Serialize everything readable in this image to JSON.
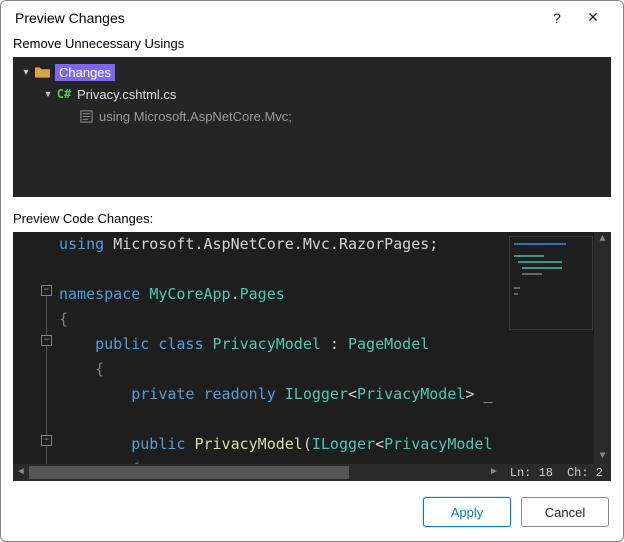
{
  "dialog": {
    "title": "Preview Changes",
    "help": "?",
    "close": "✕"
  },
  "sections": {
    "tree_label": "Remove Unnecessary Usings",
    "code_label": "Preview Code Changes:"
  },
  "tree": {
    "root": {
      "label": "Changes"
    },
    "file": {
      "label": "Privacy.cshtml.cs",
      "lang_badge": "C#"
    },
    "removed": {
      "label": "using Microsoft.AspNetCore.Mvc;"
    }
  },
  "code": {
    "tokens": [
      [
        [
          "k",
          "using "
        ],
        [
          "p",
          "Microsoft.AspNetCore.Mvc.RazorPages;"
        ]
      ],
      [],
      [
        [
          "k",
          "namespace "
        ],
        [
          "t",
          "MyCoreApp"
        ],
        [
          "p",
          "."
        ],
        [
          "t",
          "Pages"
        ]
      ],
      [
        [
          "b",
          "{"
        ]
      ],
      [
        [
          "p",
          "    "
        ],
        [
          "k",
          "public class "
        ],
        [
          "t",
          "PrivacyModel"
        ],
        [
          "p",
          " : "
        ],
        [
          "t",
          "PageModel"
        ]
      ],
      [
        [
          "p",
          "    "
        ],
        [
          "b",
          "{"
        ]
      ],
      [
        [
          "p",
          "        "
        ],
        [
          "k",
          "private readonly "
        ],
        [
          "t",
          "ILogger"
        ],
        [
          "p",
          "<"
        ],
        [
          "t",
          "PrivacyModel"
        ],
        [
          "p",
          "> _"
        ]
      ],
      [],
      [
        [
          "p",
          "        "
        ],
        [
          "k",
          "public "
        ],
        [
          "m",
          "PrivacyModel"
        ],
        [
          "p",
          "("
        ],
        [
          "t",
          "ILogger"
        ],
        [
          "p",
          "<"
        ],
        [
          "t",
          "PrivacyModel"
        ]
      ],
      [
        [
          "p",
          "        "
        ],
        [
          "b",
          "{"
        ]
      ]
    ]
  },
  "status": {
    "line_label": "Ln:",
    "line": "18",
    "col_label": "Ch:",
    "col": "2"
  },
  "buttons": {
    "apply": "Apply",
    "cancel": "Cancel"
  }
}
